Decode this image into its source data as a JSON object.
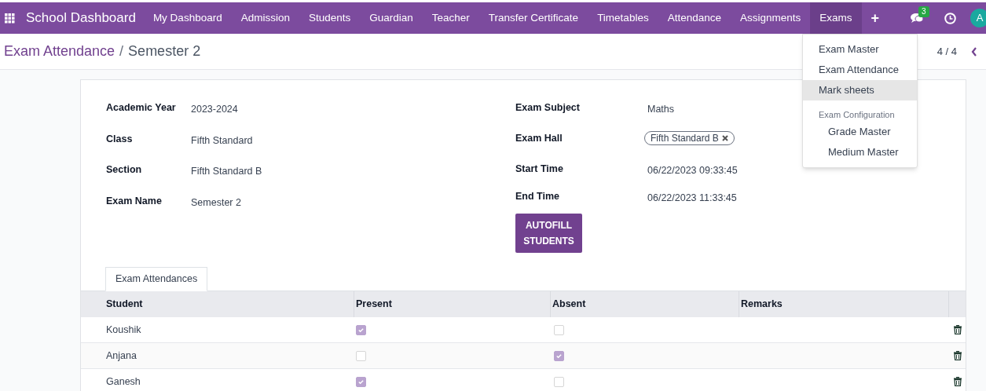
{
  "navbar": {
    "app_title": "School Dashboard",
    "menu": [
      {
        "label": "My Dashboard",
        "selected": false
      },
      {
        "label": "Admission",
        "selected": false
      },
      {
        "label": "Students",
        "selected": false
      },
      {
        "label": "Guardian",
        "selected": false
      },
      {
        "label": "Teacher",
        "selected": false
      },
      {
        "label": "Transfer Certificate",
        "selected": false
      },
      {
        "label": "Timetables",
        "selected": false
      },
      {
        "label": "Attendance",
        "selected": false
      },
      {
        "label": "Assignments",
        "selected": false
      },
      {
        "label": "Exams",
        "selected": true
      }
    ],
    "add": "+",
    "messages_count": "3",
    "avatar": "A"
  },
  "dropdown": {
    "items": [
      {
        "kind": "item",
        "label": "Exam Master",
        "selected": false
      },
      {
        "kind": "item",
        "label": "Exam Attendance",
        "selected": false
      },
      {
        "kind": "item",
        "label": "Mark sheets",
        "selected": true
      },
      {
        "kind": "header",
        "label": "Exam Configuration"
      },
      {
        "kind": "subitem",
        "label": "Grade Master",
        "selected": false
      },
      {
        "kind": "subitem",
        "label": "Medium Master",
        "selected": false
      }
    ]
  },
  "breadcrumb": {
    "parent": "Exam Attendance",
    "separator": "/",
    "current": "Semester 2"
  },
  "pager": "4 / 4",
  "form": {
    "left": [
      {
        "label": "Academic Year",
        "value": "2023-2024"
      },
      {
        "label": "Class",
        "value": "Fifth Standard"
      },
      {
        "label": "Section",
        "value": "Fifth Standard B"
      },
      {
        "label": "Exam Name",
        "value": "Semester 2"
      }
    ],
    "right": [
      {
        "kind": "text",
        "label": "Exam Subject",
        "value": "Maths"
      },
      {
        "kind": "tag",
        "label": "Exam Hall",
        "value": "Fifth Standard B"
      },
      {
        "kind": "text",
        "label": "Start Time",
        "value": "06/22/2023 09:33:45"
      },
      {
        "kind": "text",
        "label": "End Time",
        "value": "06/22/2023 11:33:45"
      }
    ],
    "button": "AUTOFILL STUDENTS"
  },
  "tabs": [
    {
      "label": "Exam Attendances",
      "selected": true
    }
  ],
  "table": {
    "columns": [
      "Student",
      "Present",
      "Absent",
      "Remarks"
    ],
    "rows": [
      {
        "student": "Koushik",
        "present": true,
        "absent": false
      },
      {
        "student": "Anjana",
        "present": false,
        "absent": true
      },
      {
        "student": "Ganesh",
        "present": true,
        "absent": false
      }
    ]
  }
}
